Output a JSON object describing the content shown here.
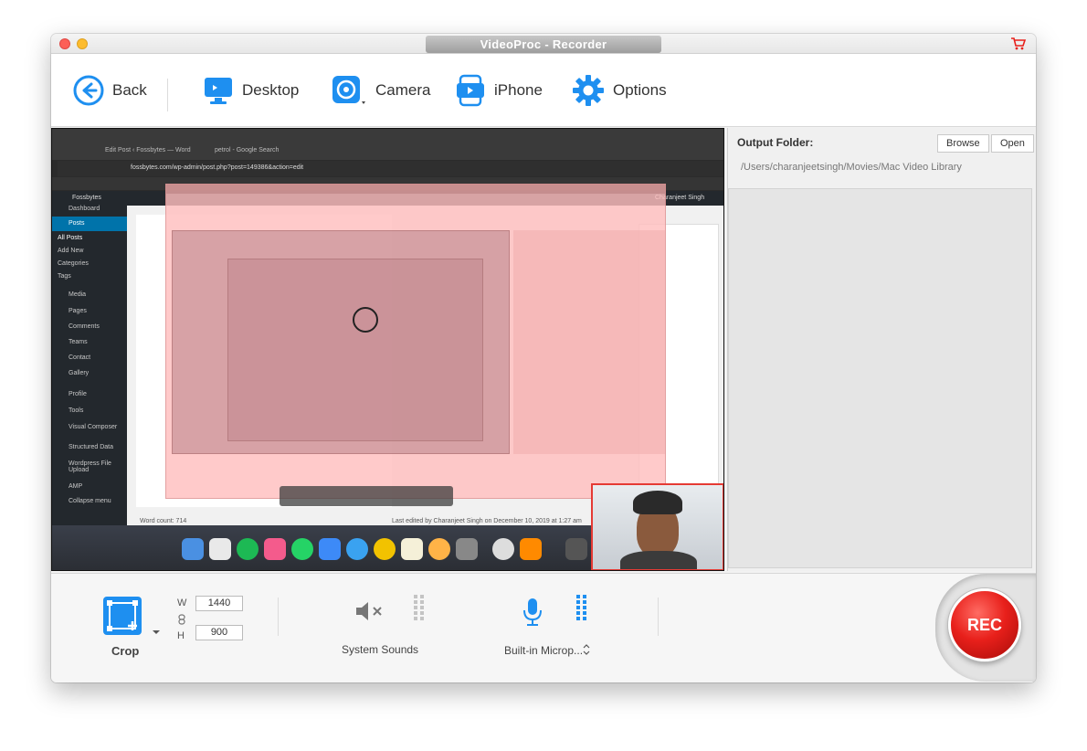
{
  "window": {
    "title": "VideoProc - Recorder"
  },
  "toolbar": {
    "back": "Back",
    "desktop": "Desktop",
    "camera": "Camera",
    "iphone": "iPhone",
    "options": "Options"
  },
  "output": {
    "label": "Output Folder:",
    "browse": "Browse",
    "open": "Open",
    "path": "/Users/charanjeetsingh/Movies/Mac Video Library"
  },
  "bottom": {
    "crop_label": "Crop",
    "width_letter": "W",
    "height_letter": "H",
    "width_value": "1440",
    "height_value": "900",
    "system_sounds": "System Sounds",
    "microphone": "Built-in Microp...",
    "rec_label": "REC"
  },
  "preview": {
    "browser_tab_1": "Edit Post ‹ Fossbytes — Word",
    "browser_tab_2": "petrol - Google Search",
    "url": "fossbytes.com/wp-admin/post.php?post=149386&action=edit",
    "wp_site": "Fossbytes",
    "wp_menu": [
      "Dashboard",
      "Posts",
      "All Posts",
      "Add New",
      "Categories",
      "Tags",
      "Media",
      "Pages",
      "Comments",
      "Teams",
      "Contact",
      "Gallery",
      "Profile",
      "Tools",
      "Visual Composer",
      "Structured Data",
      "Wordpress File Upload",
      "AMP",
      "Collapse menu"
    ],
    "word_count": "Word count: 714",
    "last_edited": "Last edited by Charanjeet Singh on December 10, 2019 at 1:27 am",
    "user": "Charanjeet Singh"
  },
  "colors": {
    "accent": "#1e8ff0",
    "rec": "#e8201b"
  }
}
